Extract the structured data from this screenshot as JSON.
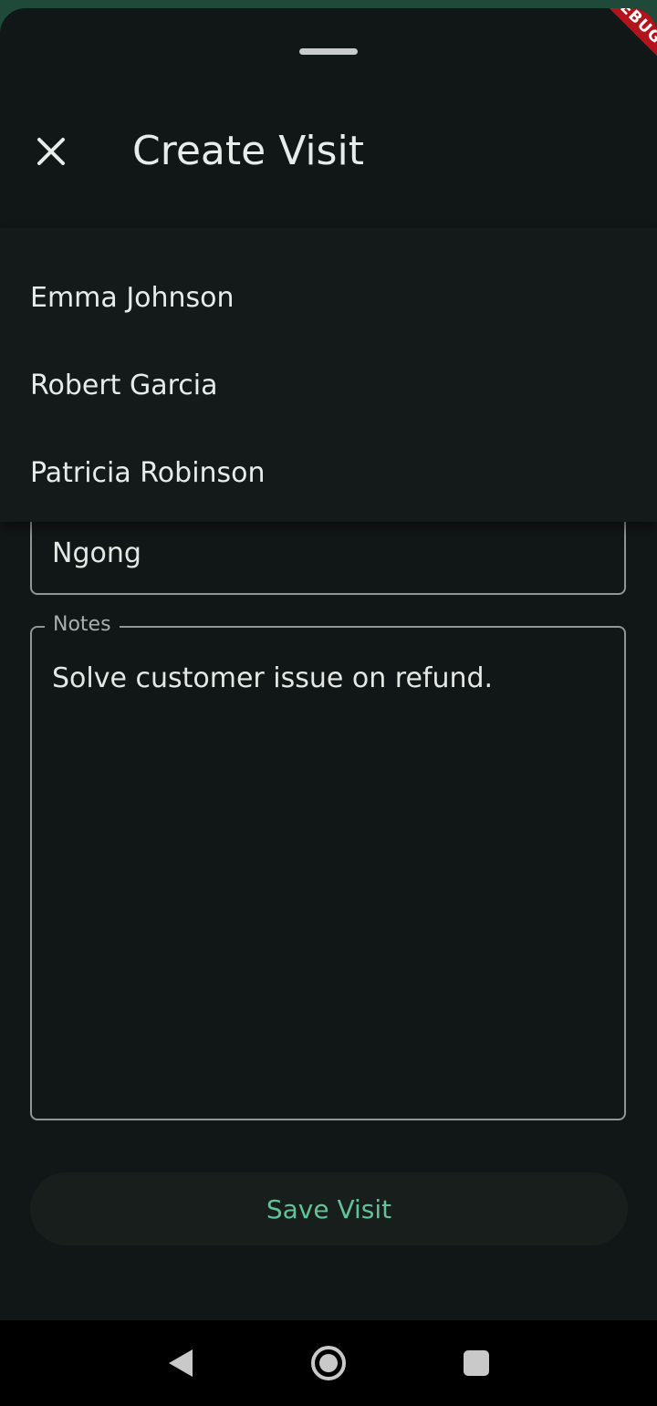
{
  "sheet": {
    "debug_banner": "DEBUG",
    "title": "Create Visit",
    "close_icon": "close-icon"
  },
  "dropdown": {
    "options": [
      {
        "label": "Emma Johnson"
      },
      {
        "label": "Robert Garcia"
      },
      {
        "label": "Patricia Robinson"
      }
    ]
  },
  "form": {
    "location_value": "Ngong",
    "notes_label": "Notes",
    "notes_value": "Solve customer issue on refund."
  },
  "actions": {
    "save_label": "Save Visit"
  },
  "colors": {
    "background": "#111716",
    "accent": "#62c29a",
    "outline": "#8f9693",
    "text": "#e6ece9"
  },
  "navbar": {
    "icons": [
      "back-triangle-icon",
      "home-circle-icon",
      "recents-square-icon"
    ]
  }
}
